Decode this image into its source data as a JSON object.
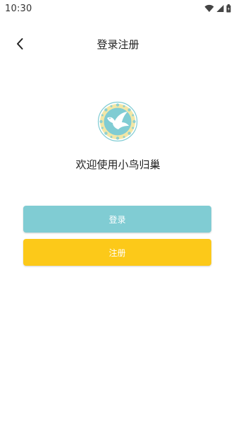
{
  "status_bar": {
    "time": "10:30",
    "icons": [
      "wifi-icon",
      "cellular-signal-icon",
      "battery-icon"
    ]
  },
  "header": {
    "back_icon": "chevron-left-icon",
    "title": "登录注册"
  },
  "logo": {
    "icon": "bird-emblem-icon",
    "colors": {
      "bird": "#ffffff",
      "circle": "#80ccd3",
      "ring": "#f3e7a6"
    }
  },
  "welcome_text": "欢迎使用小鸟归巢",
  "buttons": {
    "login_label": "登录",
    "register_label": "注册"
  },
  "colors": {
    "login_button": "#80ccd3",
    "register_button": "#fcc919",
    "background": "#ffffff"
  }
}
